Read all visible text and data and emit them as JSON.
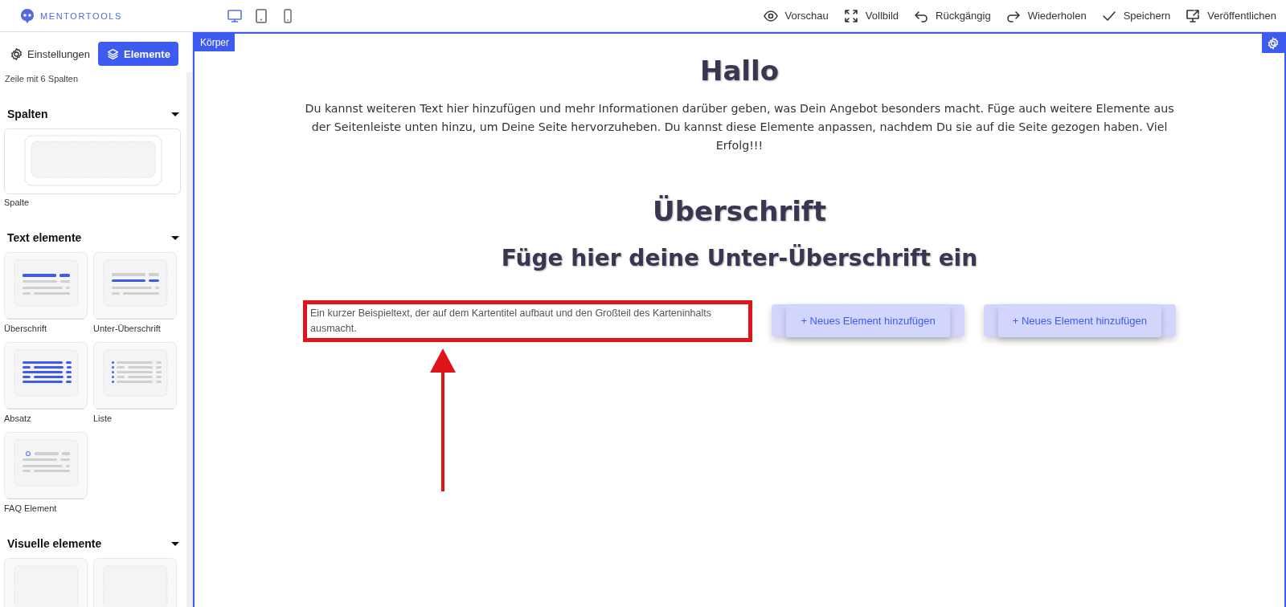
{
  "logo": {
    "text": "MENTORTOOLS"
  },
  "devices": [
    {
      "kind": "desktop",
      "selected": true
    },
    {
      "kind": "tablet",
      "selected": false
    },
    {
      "kind": "phone",
      "selected": false
    }
  ],
  "toolbar": [
    {
      "kind": "eye",
      "label": "Vorschau"
    },
    {
      "kind": "expand",
      "label": "Vollbild"
    },
    {
      "kind": "undo",
      "label": "Rückgängig"
    },
    {
      "kind": "redo",
      "label": "Wiederholen"
    },
    {
      "kind": "check",
      "label": "Speichern"
    },
    {
      "kind": "publish",
      "label": "Veröffentlichen"
    }
  ],
  "sidebar": {
    "tabs": [
      {
        "kind": "gear",
        "label": "Einstellungen",
        "selected": false
      },
      {
        "kind": "layers",
        "label": "Elemente",
        "selected": true
      }
    ],
    "top_label": "Zeile mit 6 Spalten",
    "sections": [
      {
        "title": "Spalten",
        "expanded": true,
        "items": [
          {
            "kind": "column",
            "label": "Spalte"
          }
        ]
      },
      {
        "title": "Text elemente",
        "expanded": true,
        "items": [
          {
            "kind": "heading",
            "label": "Überschrift"
          },
          {
            "kind": "subheading",
            "label": "Unter-Überschrift"
          },
          {
            "kind": "paragraph",
            "label": "Absatz"
          },
          {
            "kind": "list",
            "label": "Liste"
          },
          {
            "kind": "faq",
            "label": "FAQ Element"
          }
        ]
      },
      {
        "title": "Visuelle elemente",
        "expanded": true,
        "items": [
          {
            "kind": "blank"
          },
          {
            "kind": "blank"
          }
        ]
      }
    ]
  },
  "canvas": {
    "tag": "Körper",
    "title": "Hallo",
    "intro": "Du kannst weiteren Text hier hinzufügen und mehr Informationen darüber geben, was Dein Angebot besonders macht. Füge auch weitere Elemente aus der Seitenleiste unten hinzu, um Deine Seite hervorzuheben. Du kannst diese Elemente anpassen, nachdem Du sie auf die Seite gezogen haben. Viel Erfolg!!!",
    "heading": "Überschrift",
    "subheading": "Füge hier deine Unter-Überschrift ein",
    "cards": [
      {
        "kind": "text",
        "text": "Ein kurzer Beispieltext, der auf dem Kartentitel aufbaut und den Großteil des Karteninhalts ausmacht.",
        "highlighted": true
      },
      {
        "kind": "add",
        "label": "+ Neues Element hinzufügen",
        "highlighted": false
      },
      {
        "kind": "add",
        "label": "+ Neues Element hinzufügen",
        "highlighted": false
      }
    ]
  }
}
